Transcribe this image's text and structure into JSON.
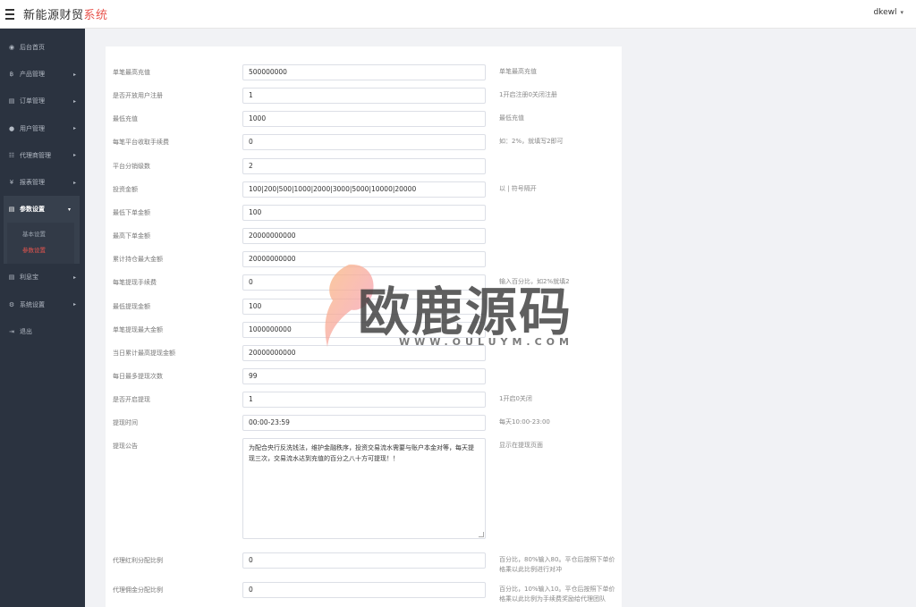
{
  "header": {
    "brand_main": "新能源财贸",
    "brand_accent": "系统",
    "username": "dkewl"
  },
  "sidebar": {
    "items": [
      {
        "label": "后台首页",
        "icon": "dashboard-icon"
      },
      {
        "label": "产品管理",
        "icon": "bitcoin-icon"
      },
      {
        "label": "订单管理",
        "icon": "document-icon"
      },
      {
        "label": "用户管理",
        "icon": "user-icon"
      },
      {
        "label": "代理商管理",
        "icon": "agent-icon"
      },
      {
        "label": "报表管理",
        "icon": "yen-icon"
      }
    ],
    "active": {
      "label": "参数设置",
      "icon": "settings-doc-icon"
    },
    "sub_items": [
      "基本设置",
      "参数设置"
    ],
    "items_after": [
      {
        "label": "利息宝",
        "icon": "document-icon"
      },
      {
        "label": "系统设置",
        "icon": "gears-icon"
      },
      {
        "label": "退出",
        "icon": "logout-icon"
      }
    ]
  },
  "form": {
    "rows": [
      {
        "label": "单笔最高充值",
        "value": "500000000",
        "hint": "单笔最高充值"
      },
      {
        "label": "是否开放用户注册",
        "value": "1",
        "hint": "1开启注册0关闭注册"
      },
      {
        "label": "最低充值",
        "value": "1000",
        "hint": "最低充值"
      },
      {
        "label": "每笔平台收取手续费",
        "value": "0",
        "hint": "如：2%，就填写2即可"
      },
      {
        "label": "平台分销级数",
        "value": "2",
        "hint": ""
      },
      {
        "label": "投资金额",
        "value": "100|200|500|1000|2000|3000|5000|10000|20000",
        "hint": "以 | 符号隔开"
      },
      {
        "label": "最低下单金额",
        "value": "100",
        "hint": ""
      },
      {
        "label": "最高下单金额",
        "value": "20000000000",
        "hint": ""
      },
      {
        "label": "累计持仓最大金额",
        "value": "20000000000",
        "hint": ""
      },
      {
        "label": "每笔提现手续费",
        "value": "0",
        "hint": "输入百分比，如2%就填2"
      },
      {
        "label": "最低提现金额",
        "value": "100",
        "hint": ""
      },
      {
        "label": "单笔提现最大金额",
        "value": "1000000000",
        "hint": ""
      },
      {
        "label": "当日累计最高提现金额",
        "value": "20000000000",
        "hint": ""
      },
      {
        "label": "每日最多提现次数",
        "value": "99",
        "hint": ""
      },
      {
        "label": "是否开启提现",
        "value": "1",
        "hint": "1开启0关闭"
      },
      {
        "label": "提现时间",
        "value": "00:00-23:59",
        "hint": "每天10:00-23:00"
      }
    ],
    "notice": {
      "label": "提现公告",
      "value": "为配合央行反洗钱法，维护金融秩序，投资交易流水需要与账户本金对等，每天提现三次，交易流水达到充值的百分之八十方可提现！！",
      "hint": "显示在提现页面"
    },
    "rows_after": [
      {
        "label": "代理红利分配比例",
        "value": "0",
        "hint": "百分比，80%输入80。平仓后按照下单价格乘以此比例进行对冲"
      },
      {
        "label": "代理佣金分配比例",
        "value": "0",
        "hint": "百分比，10%输入10。平仓后按照下单价格乘以此比例为手续费奖励给代理团队"
      }
    ]
  },
  "watermark": {
    "text": "欧鹿源码",
    "sub": "WWW.OULUYM.COM"
  }
}
